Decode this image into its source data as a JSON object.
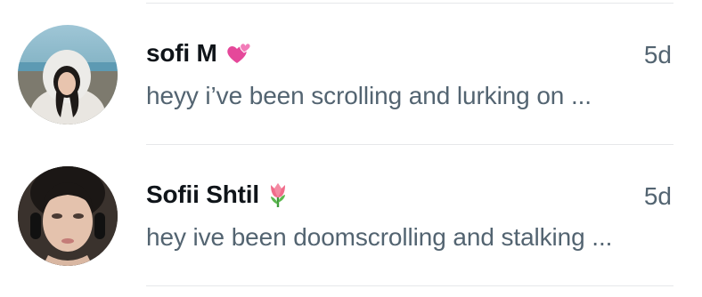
{
  "conversations": [
    {
      "name": "sofi M",
      "badge_icon": "two-hearts-emoji",
      "time": "5d",
      "preview": "heyy i’ve been scrolling and lurking on ..."
    },
    {
      "name": "Sofii Shtil",
      "badge_icon": "tulip-emoji",
      "time": "5d",
      "preview": "hey ive been doomscrolling and stalking ..."
    }
  ],
  "colors": {
    "name_text": "#0f1419",
    "secondary_text": "#536471",
    "divider": "#e6e8ea"
  }
}
